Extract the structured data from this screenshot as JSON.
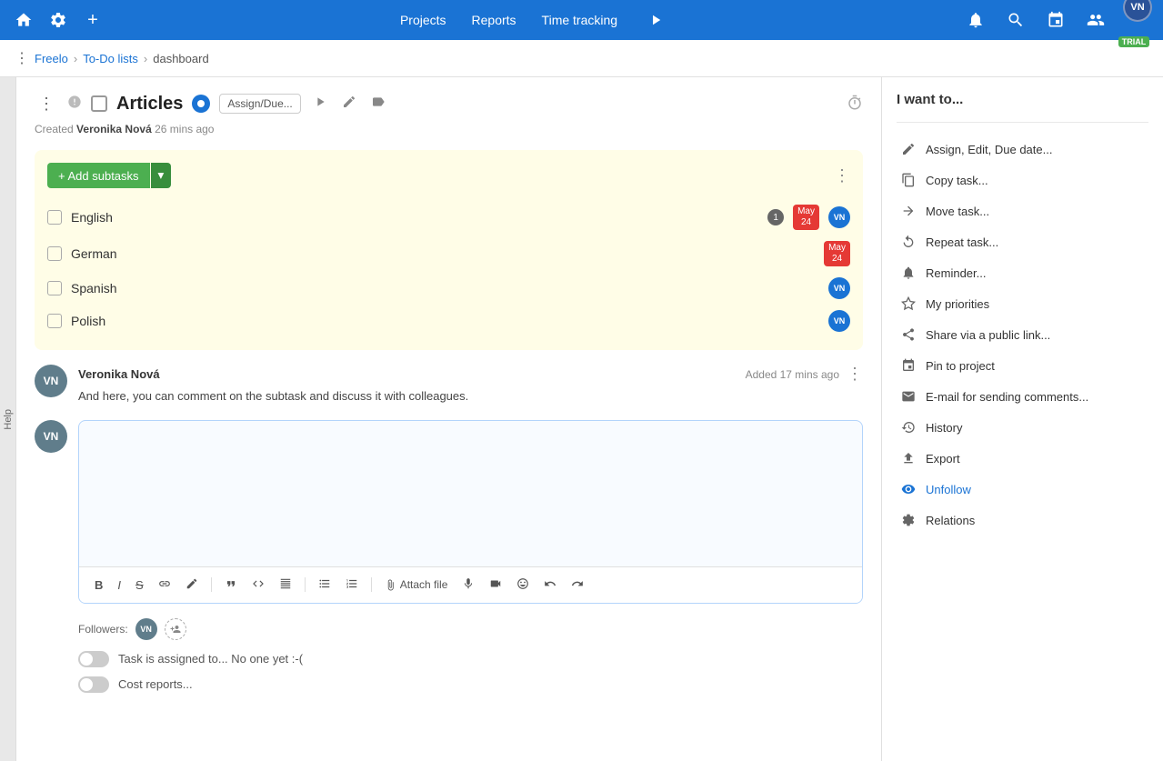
{
  "topnav": {
    "home_icon": "🏠",
    "settings_icon": "⚙",
    "new_icon": "+",
    "links": [
      "Projects",
      "Reports",
      "Time tracking"
    ],
    "play_icon": "▷",
    "bell_icon": "🔔",
    "search_icon": "🔍",
    "calendar_icon": "📅",
    "users_icon": "👥",
    "avatar_initials": "VN",
    "trial_label": "TRIAL"
  },
  "breadcrumb": {
    "brand": "Freelo",
    "sep1": "›",
    "item1": "To-Do lists",
    "sep2": "›",
    "item2": "dashboard"
  },
  "task": {
    "title": "Articles",
    "assign_due_label": "Assign/Due...",
    "created_by_prefix": "Created",
    "author": "Veronika Nová",
    "time_ago": "26 mins ago"
  },
  "subtasks": {
    "add_button": "+ Add subtasks",
    "items": [
      {
        "name": "English",
        "badge": "1",
        "date_month": "May",
        "date_day": "24",
        "avatar": "VN"
      },
      {
        "name": "German",
        "date_month": "May",
        "date_day": "24",
        "avatar": ""
      },
      {
        "name": "Spanish",
        "avatar": "VN"
      },
      {
        "name": "Polish",
        "avatar": "VN"
      }
    ]
  },
  "comment": {
    "avatar": "VN",
    "author": "Veronika Nová",
    "time": "Added 17 mins ago",
    "text": "And here, you can comment on the subtask and discuss it with colleagues."
  },
  "editor": {
    "avatar": "VN",
    "placeholder": ""
  },
  "toolbar": {
    "bold": "B",
    "italic": "I",
    "strikethrough": "S",
    "link": "🔗",
    "pen": "✏",
    "quote": "\"",
    "code": "<>",
    "align": "≡",
    "list_ul": "≡",
    "list_ol": "1.",
    "attach_label": "Attach file",
    "mic": "🎤",
    "video": "▶",
    "emoji": "😊",
    "undo": "↩",
    "redo": "↪"
  },
  "followers": {
    "label": "Followers:",
    "avatar": "VN"
  },
  "toggles": [
    {
      "label": "Task is assigned to... No one yet :-("
    },
    {
      "label": "Cost reports..."
    }
  ],
  "sidebar": {
    "title": "I want to...",
    "items": [
      {
        "icon": "✏",
        "label": "Assign, Edit, Due date..."
      },
      {
        "icon": "⧉",
        "label": "Copy task..."
      },
      {
        "icon": "→",
        "label": "Move task..."
      },
      {
        "icon": "↺",
        "label": "Repeat task..."
      },
      {
        "icon": "🔔",
        "label": "Reminder..."
      },
      {
        "icon": "★",
        "label": "My priorities",
        "active": false
      },
      {
        "icon": "⬆",
        "label": "Share via a public link..."
      },
      {
        "icon": "📌",
        "label": "Pin to project"
      },
      {
        "icon": "✉",
        "label": "E-mail for sending comments..."
      },
      {
        "icon": "📄",
        "label": "History"
      },
      {
        "icon": "⬆",
        "label": "Export"
      },
      {
        "icon": "👁",
        "label": "Unfollow",
        "blue": true
      },
      {
        "icon": "⚙",
        "label": "Relations"
      }
    ]
  }
}
